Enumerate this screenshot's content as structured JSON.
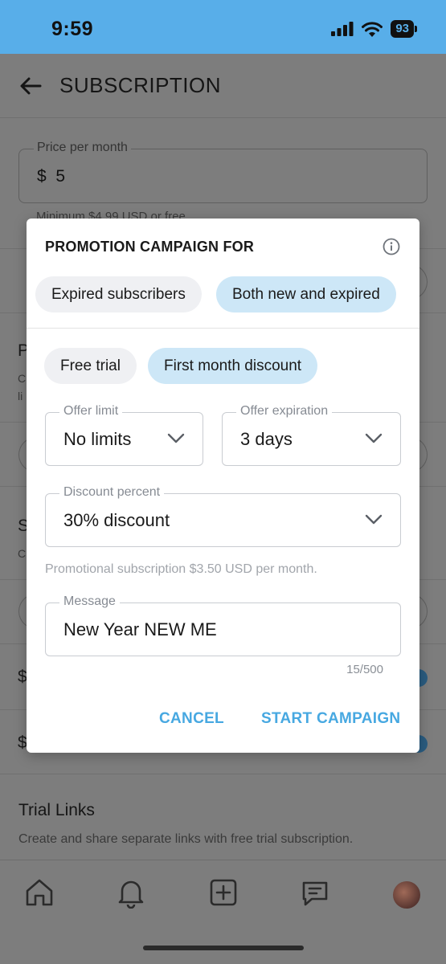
{
  "status_bar": {
    "time": "9:59",
    "battery": "93"
  },
  "header": {
    "title": "SUBSCRIPTION",
    "back_icon": "back-arrow-icon"
  },
  "price": {
    "label": "Price per month",
    "currency": "$",
    "value": "5",
    "hint": "Minimum $4.99 USD or free"
  },
  "background_fragments": {
    "section_a_letter": "P",
    "section_a_line1": "C",
    "section_a_line2": "li",
    "section_b_letter": "S",
    "section_b_line1": "C",
    "row1_letter": "$",
    "row2_letter": "$"
  },
  "trial_links": {
    "title": "Trial Links",
    "description": "Create and share separate links with free trial subscription."
  },
  "tab_bar": {
    "icons": [
      "home-icon",
      "bell-icon",
      "add-post-icon",
      "messages-icon",
      "profile-avatar"
    ]
  },
  "dialog": {
    "title": "PROMOTION CAMPAIGN FOR",
    "audience_options": [
      {
        "label": "Expired subscribers",
        "selected": false
      },
      {
        "label": "Both new and expired",
        "selected": true
      }
    ],
    "type_options": [
      {
        "label": "Free trial",
        "selected": false
      },
      {
        "label": "First month discount",
        "selected": true
      }
    ],
    "offer_limit": {
      "label": "Offer limit",
      "value": "No limits"
    },
    "offer_expiration": {
      "label": "Offer expiration",
      "value": "3 days"
    },
    "discount_percent": {
      "label": "Discount percent",
      "value": "30% discount"
    },
    "promo_note": "Promotional subscription $3.50 USD per month.",
    "message": {
      "label": "Message",
      "value": "New Year NEW ME"
    },
    "char_counter": "15/500",
    "cancel_label": "CANCEL",
    "start_label": "START CAMPAIGN",
    "accent_color": "#47a8e1",
    "selected_chip_color": "#cde7f7"
  }
}
